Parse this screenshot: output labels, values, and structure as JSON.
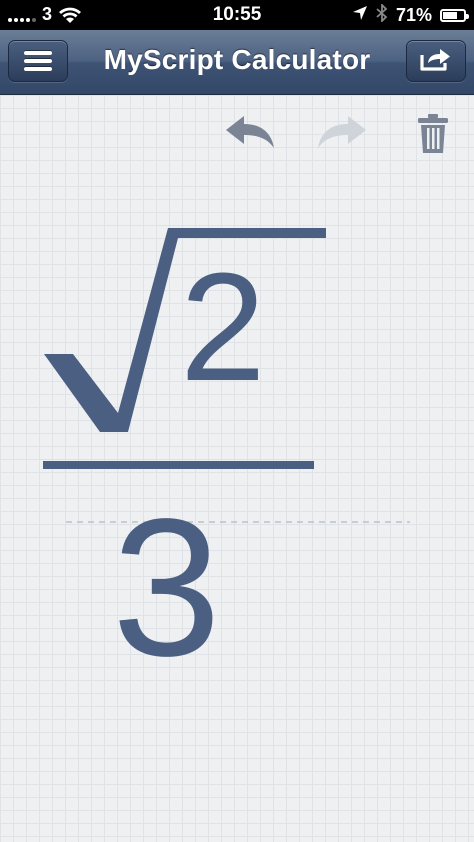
{
  "status_bar": {
    "carrier": "3",
    "time": "10:55",
    "battery": "71%",
    "battery_level": 0.71
  },
  "nav": {
    "title": "MyScript Calculator",
    "menu_icon": "hamburger-menu-icon",
    "share_icon": "share-icon"
  },
  "toolbar": {
    "undo_icon": "undo-icon",
    "redo_icon": "redo-icon",
    "trash_icon": "trash-icon"
  },
  "expression": {
    "numerator": "2",
    "denominator": "3",
    "operator": "sqrt"
  },
  "colors": {
    "ink": "#4b5f82",
    "nav_bar": "#4d6282",
    "canvas": "#eef0f2"
  }
}
